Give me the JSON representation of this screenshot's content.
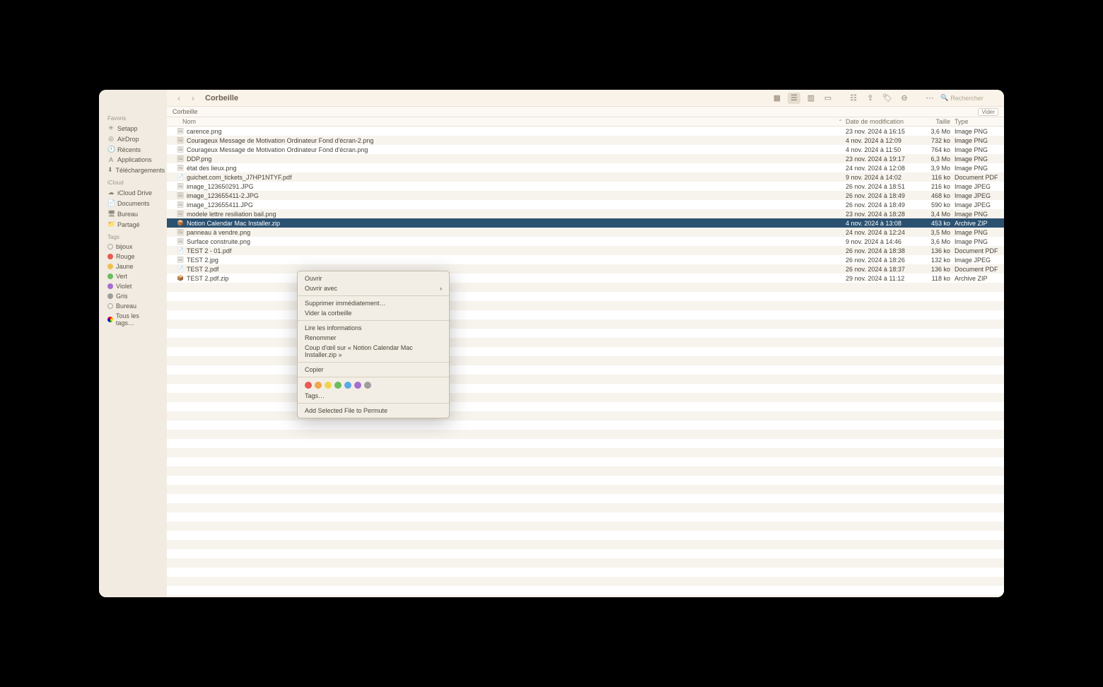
{
  "window_title": "Corbeille",
  "path": "Corbeille",
  "search_placeholder": "Rechercher",
  "empty_button": "Vider",
  "sidebar": {
    "sections": [
      {
        "title": "Favoris",
        "items": [
          {
            "label": "Setapp",
            "icon": "✳"
          },
          {
            "label": "AirDrop",
            "icon": "◎"
          },
          {
            "label": "Récents",
            "icon": "🕘"
          },
          {
            "label": "Applications",
            "icon": "A"
          },
          {
            "label": "Téléchargements",
            "icon": "⬇"
          }
        ]
      },
      {
        "title": "iCloud",
        "items": [
          {
            "label": "iCloud Drive",
            "icon": "☁"
          },
          {
            "label": "Documents",
            "icon": "📄"
          },
          {
            "label": "Bureau",
            "icon": "🖥"
          },
          {
            "label": "Partagé",
            "icon": "📁"
          }
        ]
      },
      {
        "title": "Tags",
        "items": [
          {
            "label": "bijoux",
            "color": "transparent"
          },
          {
            "label": "Rouge",
            "color": "#e85b52"
          },
          {
            "label": "Jaune",
            "color": "#f1bf4d"
          },
          {
            "label": "Vert",
            "color": "#6bbb5f"
          },
          {
            "label": "Violet",
            "color": "#a66dd1"
          },
          {
            "label": "Gris",
            "color": "#9e9e9e"
          },
          {
            "label": "Bureau",
            "color": "transparent"
          },
          {
            "label": "Tous les tags…",
            "color": "multi"
          }
        ]
      }
    ]
  },
  "columns": {
    "name": "Nom",
    "date": "Date de modification",
    "size": "Taille",
    "type": "Type"
  },
  "files": [
    {
      "name": "carence.png",
      "date": "23 nov. 2024 à 16:15",
      "size": "3,6 Mo",
      "type": "Image PNG",
      "icon": "🖼"
    },
    {
      "name": "Courageux Message de Motivation Ordinateur Fond d'écran-2.png",
      "date": "4 nov. 2024 à 12:09",
      "size": "732 ko",
      "type": "Image PNG",
      "icon": "🖼"
    },
    {
      "name": "Courageux Message de Motivation Ordinateur Fond d'écran.png",
      "date": "4 nov. 2024 à 11:50",
      "size": "764 ko",
      "type": "Image PNG",
      "icon": "🖼"
    },
    {
      "name": "DDP.png",
      "date": "23 nov. 2024 à 19:17",
      "size": "6,3 Mo",
      "type": "Image PNG",
      "icon": "🖼"
    },
    {
      "name": "état des lieux.png",
      "date": "24 nov. 2024 à 12:08",
      "size": "3,9 Mo",
      "type": "Image PNG",
      "icon": "🖼"
    },
    {
      "name": "guichet.com_tickets_J7HP1NTYF.pdf",
      "date": "9 nov. 2024 à 14:02",
      "size": "116 ko",
      "type": "Document PDF",
      "icon": "📄"
    },
    {
      "name": "image_123650291.JPG",
      "date": "26 nov. 2024 à 18:51",
      "size": "216 ko",
      "type": "Image JPEG",
      "icon": "🖼"
    },
    {
      "name": "image_123655411-2.JPG",
      "date": "26 nov. 2024 à 18:49",
      "size": "468 ko",
      "type": "Image JPEG",
      "icon": "🖼"
    },
    {
      "name": "image_123655411.JPG",
      "date": "26 nov. 2024 à 18:49",
      "size": "590 ko",
      "type": "Image JPEG",
      "icon": "🖼"
    },
    {
      "name": "modele lettre resiliation bail.png",
      "date": "23 nov. 2024 à 18:28",
      "size": "3,4 Mo",
      "type": "Image PNG",
      "icon": "🖼"
    },
    {
      "name": "Notion Calendar Mac Installer.zip",
      "date": "4 nov. 2024 à 13:08",
      "size": "453 ko",
      "type": "Archive ZIP",
      "icon": "📦",
      "selected": true
    },
    {
      "name": "panneau à vendre.png",
      "date": "24 nov. 2024 à 12:24",
      "size": "3,5 Mo",
      "type": "Image PNG",
      "icon": "🖼"
    },
    {
      "name": "Surface construite.png",
      "date": "9 nov. 2024 à 14:46",
      "size": "3,6 Mo",
      "type": "Image PNG",
      "icon": "🖼"
    },
    {
      "name": "TEST 2 - 01.pdf",
      "date": "26 nov. 2024 à 18:38",
      "size": "136 ko",
      "type": "Document PDF",
      "icon": "📄"
    },
    {
      "name": "TEST 2.jpg",
      "date": "26 nov. 2024 à 18:26",
      "size": "132 ko",
      "type": "Image JPEG",
      "icon": "🖼"
    },
    {
      "name": "TEST 2.pdf",
      "date": "26 nov. 2024 à 18:37",
      "size": "136 ko",
      "type": "Document PDF",
      "icon": "📄"
    },
    {
      "name": "TEST 2.pdf.zip",
      "date": "29 nov. 2024 à 11:12",
      "size": "118 ko",
      "type": "Archive ZIP",
      "icon": "📦"
    }
  ],
  "context_menu": {
    "open": "Ouvrir",
    "open_with": "Ouvrir avec",
    "delete_now": "Supprimer immédiatement…",
    "empty_trash": "Vider la corbeille",
    "get_info": "Lire les informations",
    "rename": "Renommer",
    "quicklook": "Coup d'œil sur « Notion Calendar Mac Installer.zip »",
    "copy": "Copier",
    "tags": "Tags…",
    "add_to_permute": "Add Selected File to Permute",
    "tag_colors": [
      "#e85b52",
      "#f0a64b",
      "#f1d44d",
      "#6bbb5f",
      "#5ba7e8",
      "#a66dd1",
      "#9e9e9e"
    ]
  }
}
